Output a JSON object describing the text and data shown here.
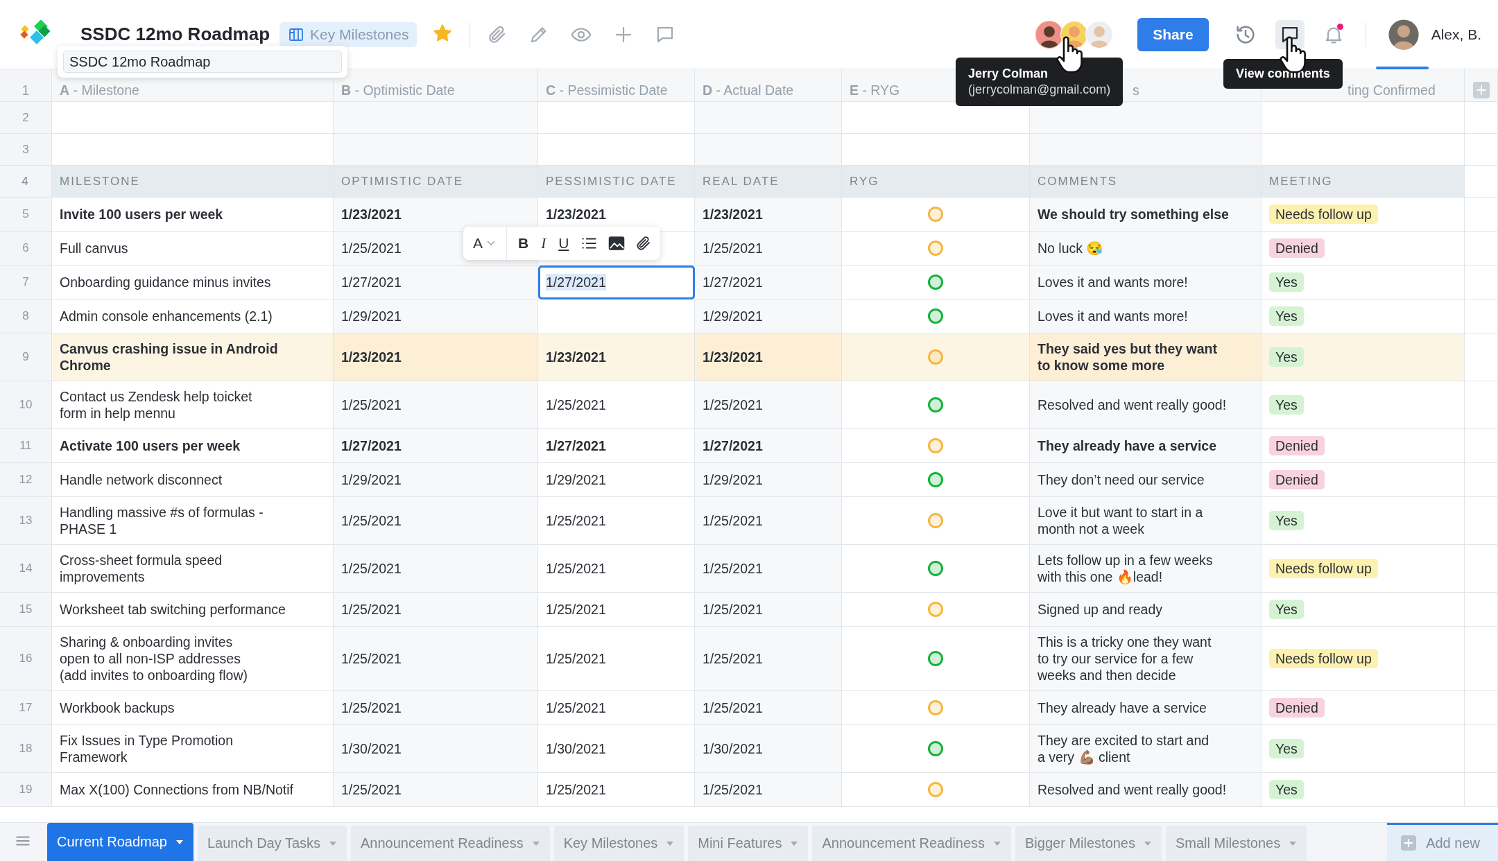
{
  "app": {
    "title": "SSDC 12mo Roadmap",
    "view_badge": "Key Milestones",
    "starred": true
  },
  "rename_popup": {
    "value": "SSDC 12mo Roadmap"
  },
  "share_button": "Share",
  "notifications": {
    "has_unread": true
  },
  "user": {
    "name": "Alex, B."
  },
  "tooltips": [
    {
      "title": "Jerry Colman",
      "subtitle": "(jerrycolman@gmail.com)"
    },
    {
      "title": "View comments"
    }
  ],
  "format_toolbar": {
    "font_button": "A",
    "bold_button": "B",
    "italic_button": "I",
    "underline_button": "U"
  },
  "sheet": {
    "letter_row": {
      "number": "1",
      "cells": [
        "**A** - Milestone",
        "**B** - Optimistic Date",
        "**C** - Pessimistic Date",
        "**D** - Actual Date",
        "**E** - RYG",
        "s",
        "ting Confirmed"
      ]
    },
    "blank_rows": [
      "2",
      "3"
    ],
    "label_row": {
      "number": "4",
      "cells": [
        "MILESTONE",
        "OPTIMISTIC DATE",
        "PESSIMISTIC DATE",
        "REAL DATE",
        "RYG",
        "COMMENTS",
        "MEETING"
      ]
    },
    "rows": [
      {
        "number": "5",
        "milestone": "Invite 100 users per week",
        "optimistic": "1/23/2021",
        "pessimistic": "1/23/2021",
        "real": "1/23/2021",
        "color": "#f4b73f",
        "comment": "We should try something else",
        "meeting": {
          "text": "Needs follow up",
          "color": "#fdf1b0"
        },
        "bold": true,
        "highlighted": false,
        "editing": false
      },
      {
        "number": "6",
        "milestone": "Full canvus",
        "optimistic": "1/25/2021",
        "real": "1/25/2021",
        "color": "#f4b73f",
        "comment": "No luck 😪",
        "meeting": {
          "text": "Denied",
          "color": "#f8d2dc"
        },
        "bold": false,
        "highlighted": false,
        "editing": false
      },
      {
        "number": "7",
        "milestone": "Onboarding guidance minus invites",
        "optimistic": "1/27/2021",
        "pessimistic": "1/27/2021",
        "real": "1/27/2021",
        "color": "#13b33a",
        "comment": "Loves it and wants more!",
        "meeting": {
          "text": "Yes",
          "color": "#d5f3d3"
        },
        "bold": false,
        "highlighted": false,
        "editing": true
      },
      {
        "number": "8",
        "milestone": "Admin console enhancements (2.1)",
        "optimistic": "1/29/2021",
        "real": "1/29/2021",
        "color": "#13b33a",
        "comment": "Loves it and wants more!",
        "meeting": {
          "text": "Yes",
          "color": "#d5f3d3"
        },
        "bold": false,
        "highlighted": false,
        "editing": false
      },
      {
        "number": "9",
        "milestone": "Canvus crashing issue in Android\nChrome",
        "optimistic": "1/23/2021",
        "pessimistic": "1/23/2021",
        "real": "1/23/2021",
        "color": "#f4b73f",
        "comment": "They said yes but they want\nto know some more",
        "meeting": {
          "text": "Yes",
          "color": "#d5f3d3"
        },
        "bold": true,
        "highlighted": true,
        "editing": false
      },
      {
        "number": "10",
        "milestone": "Contact us Zendesk help toicket\nform in help mennu",
        "optimistic": "1/25/2021",
        "pessimistic": "1/25/2021",
        "real": "1/25/2021",
        "color": "#13b33a",
        "comment": "Resolved and went really good!",
        "meeting": {
          "text": "Yes",
          "color": "#d5f3d3"
        },
        "bold": false,
        "highlighted": false,
        "editing": false
      },
      {
        "number": "11",
        "milestone": "Activate 100 users per week",
        "optimistic": "1/27/2021",
        "pessimistic": "1/27/2021",
        "real": "1/27/2021",
        "color": "#f4b73f",
        "comment": "They already have a service",
        "meeting": {
          "text": "Denied",
          "color": "#f8d2dc"
        },
        "bold": true,
        "highlighted": false,
        "editing": false
      },
      {
        "number": "12",
        "milestone": "Handle network disconnect",
        "optimistic": "1/29/2021",
        "pessimistic": "1/29/2021",
        "real": "1/29/2021",
        "color": "#13b33a",
        "comment": "They don’t need our service",
        "meeting": {
          "text": "Denied",
          "color": "#f8d2dc"
        },
        "bold": false,
        "highlighted": false,
        "editing": false
      },
      {
        "number": "13",
        "milestone": "Handling massive #s of formulas -\nPHASE 1",
        "optimistic": "1/25/2021",
        "pessimistic": "1/25/2021",
        "real": "1/25/2021",
        "color": "#f4b73f",
        "comment": "Love it but want to start in a\nmonth not a week",
        "meeting": {
          "text": "Yes",
          "color": "#d5f3d3"
        },
        "bold": false,
        "highlighted": false,
        "editing": false
      },
      {
        "number": "14",
        "milestone": "Cross-sheet formula speed\nimprovements",
        "optimistic": "1/25/2021",
        "pessimistic": "1/25/2021",
        "real": "1/25/2021",
        "color": "#13b33a",
        "comment": "Lets follow up in a few weeks\nwith this one 🔥lead!",
        "meeting": {
          "text": "Needs follow up",
          "color": "#fdf1b0"
        },
        "bold": false,
        "highlighted": false,
        "editing": false
      },
      {
        "number": "15",
        "milestone": "Worksheet tab switching performance",
        "optimistic": "1/25/2021",
        "pessimistic": "1/25/2021",
        "real": "1/25/2021",
        "color": "#f4b73f",
        "comment": "Signed up and ready",
        "meeting": {
          "text": "Yes",
          "color": "#d5f3d3"
        },
        "bold": false,
        "highlighted": false,
        "editing": false
      },
      {
        "number": "16",
        "milestone": "Sharing & onboarding invites\nopen to all non-ISP addresses\n(add invites to onboarding flow)",
        "optimistic": "1/25/2021",
        "pessimistic": "1/25/2021",
        "real": "1/25/2021",
        "color": "#13b33a",
        "comment": "This is a tricky one they want\nto try our service for a few\nweeks and then decide",
        "meeting": {
          "text": "Needs follow up",
          "color": "#fdf1b0"
        },
        "bold": false,
        "highlighted": false,
        "editing": false
      },
      {
        "number": "17",
        "milestone": "Workbook backups",
        "optimistic": "1/25/2021",
        "pessimistic": "1/25/2021",
        "real": "1/25/2021",
        "color": "#f4b73f",
        "comment": "They already have a service",
        "meeting": {
          "text": "Denied",
          "color": "#f8d2dc"
        },
        "bold": false,
        "highlighted": false,
        "editing": false
      },
      {
        "number": "18",
        "milestone": "Fix Issues in Type Promotion\nFramework",
        "optimistic": "1/30/2021",
        "pessimistic": "1/30/2021",
        "real": "1/30/2021",
        "color": "#13b33a",
        "comment": "They are excited to start and\na very 💪🏽 client",
        "meeting": {
          "text": "Yes",
          "color": "#d5f3d3"
        },
        "bold": false,
        "highlighted": false,
        "editing": false
      },
      {
        "number": "19",
        "milestone": "Max X(100) Connections from NB/Notif",
        "optimistic": "1/25/2021",
        "pessimistic": "1/25/2021",
        "real": "1/25/2021",
        "color": "#f4b73f",
        "comment": "Resolved and went really good!",
        "meeting": {
          "text": "Yes",
          "color": "#d5f3d3"
        },
        "bold": false,
        "highlighted": false,
        "editing": false
      }
    ]
  },
  "tabs": [
    {
      "label": "Current Roadmap",
      "selected": true
    },
    {
      "label": "Launch Day Tasks",
      "selected": false
    },
    {
      "label": "Announcement Readiness",
      "selected": false
    },
    {
      "label": "Key Milestones",
      "selected": false
    },
    {
      "label": "Mini Features",
      "selected": false
    },
    {
      "label": "Announcement Readiness",
      "selected": false
    },
    {
      "label": "Bigger Milestones",
      "selected": false
    },
    {
      "label": "Small Milestones",
      "selected": false
    }
  ],
  "add_tab": "Add new"
}
